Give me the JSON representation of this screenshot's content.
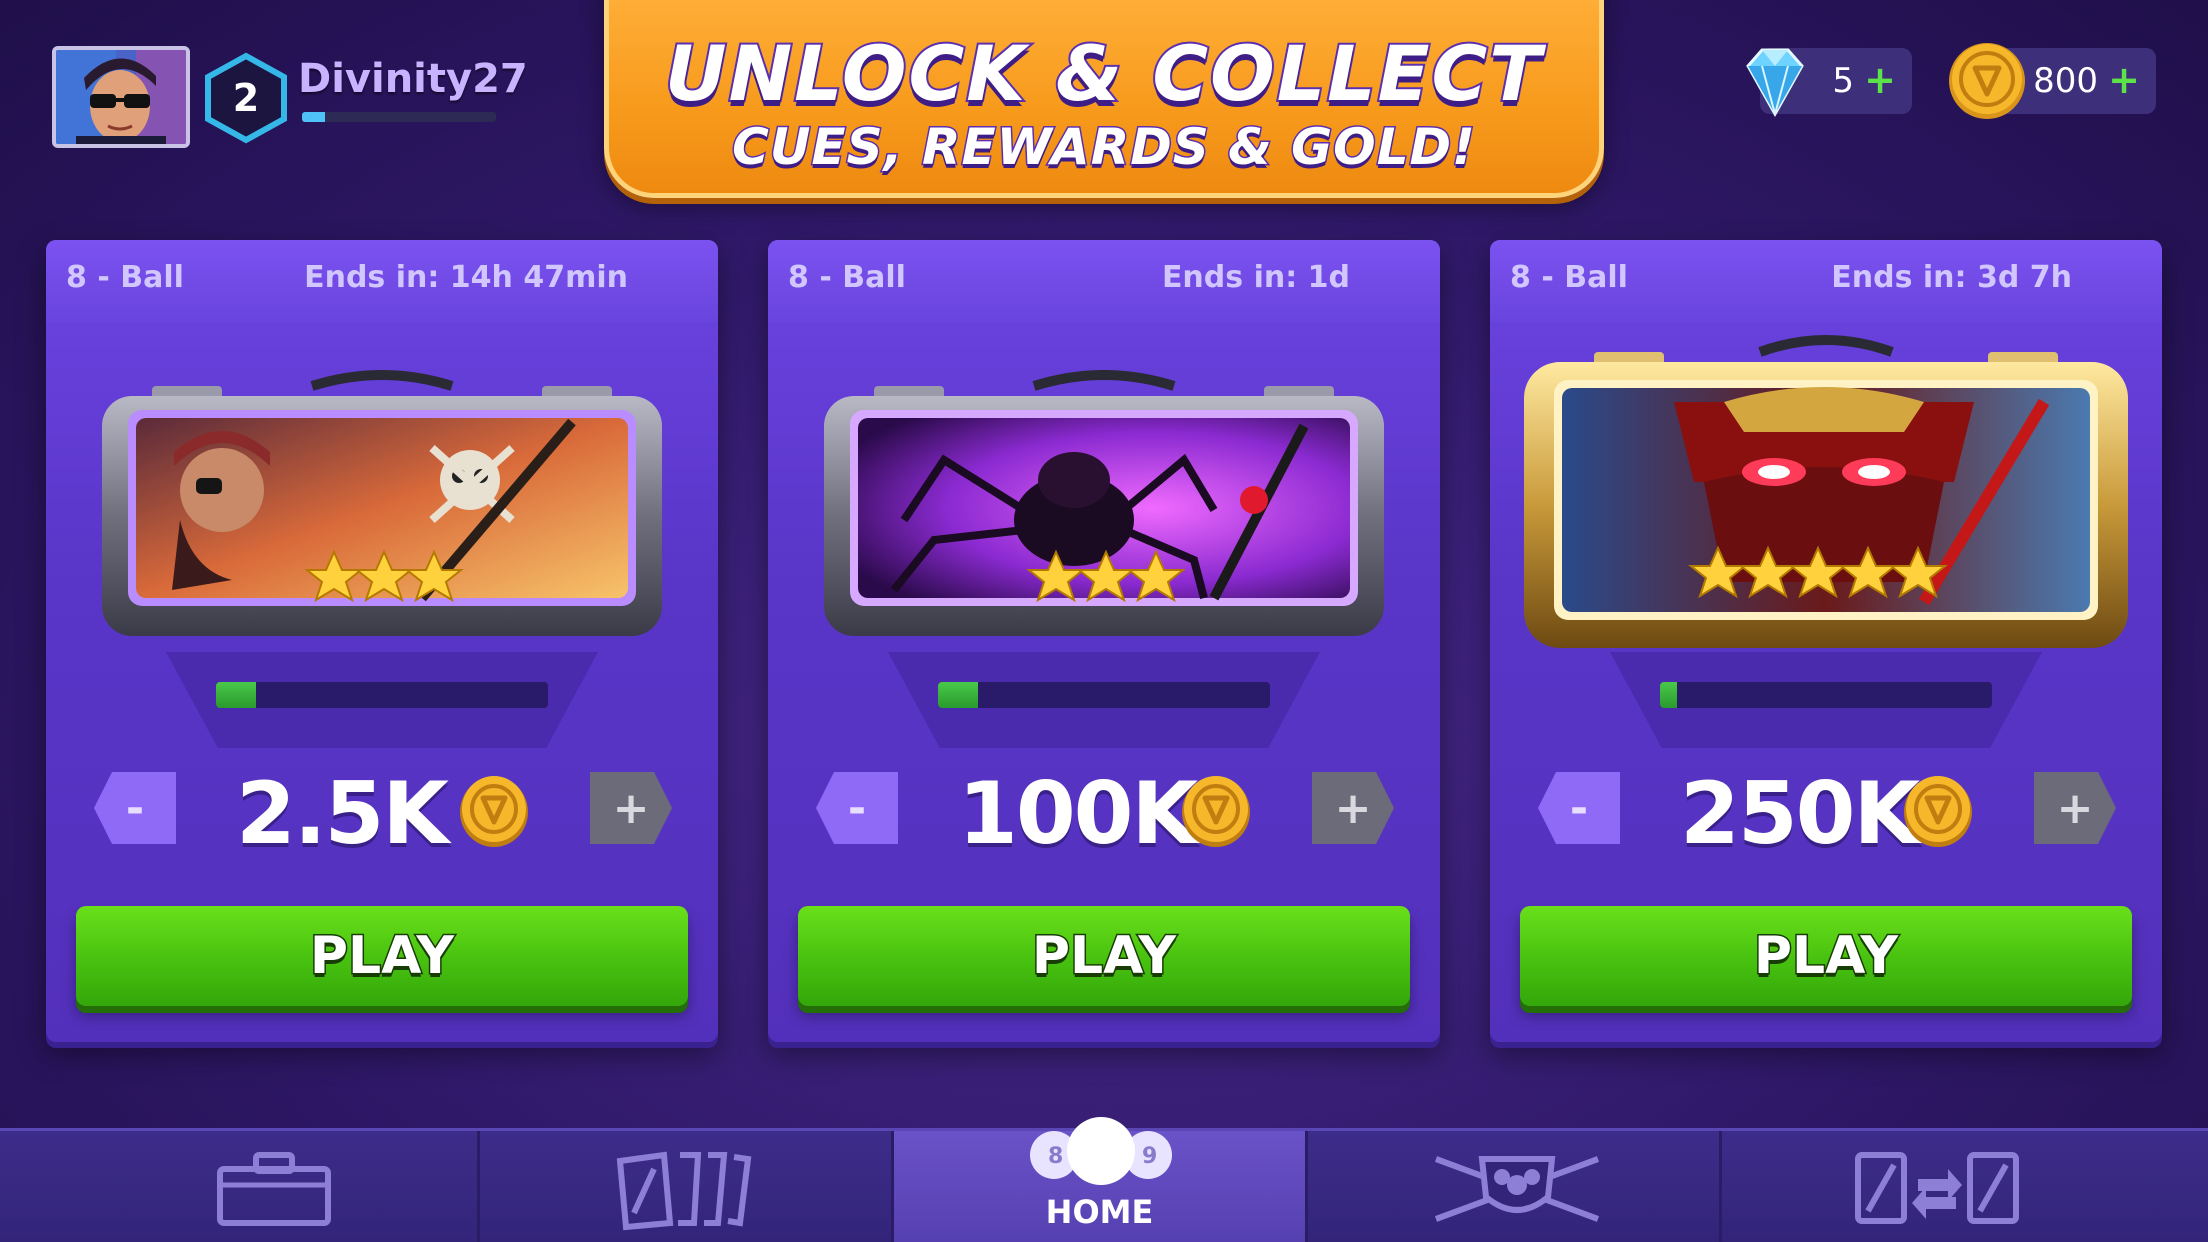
{
  "player": {
    "name": "Divinity27",
    "level": "2",
    "xp_progress": 0.12
  },
  "banner": {
    "line1": "UNLOCK & COLLECT",
    "line2": "CUES, REWARDS & GOLD!"
  },
  "currencies": {
    "gems": {
      "value": "5",
      "plus": "+",
      "icon": "diamond-icon"
    },
    "coins": {
      "value": "800",
      "plus": "+",
      "icon": "gold-coin-icon"
    }
  },
  "cards": [
    {
      "mode": "8 - Ball",
      "ends": "Ends in: 14h 47min",
      "stars": 3,
      "progress": 0.12,
      "stake": "2.5K",
      "minus": "-",
      "plus": "+",
      "play": "PLAY",
      "theme": "pirate-cue-case"
    },
    {
      "mode": "8 - Ball",
      "ends": "Ends in: 1d",
      "stars": 3,
      "progress": 0.12,
      "stake": "100K",
      "minus": "-",
      "plus": "+",
      "play": "PLAY",
      "theme": "spider-cue-case"
    },
    {
      "mode": "8 - Ball",
      "ends": "Ends in: 3d 7h",
      "stars": 5,
      "progress": 0.05,
      "stake": "250K",
      "minus": "-",
      "plus": "+",
      "play": "PLAY",
      "theme": "samurai-cue-case"
    }
  ],
  "nav": {
    "items": [
      {
        "name": "briefcase-icon"
      },
      {
        "name": "cue-cards-icon"
      },
      {
        "name": "billiard-balls-icon",
        "label": "HOME"
      },
      {
        "name": "club-shield-icon"
      },
      {
        "name": "trade-icon"
      }
    ]
  },
  "colors": {
    "background": "#2f1868",
    "card": "#6d44e3",
    "banner": "#f79a1c",
    "play": "#47c10f",
    "gold": "#f6b82a"
  }
}
